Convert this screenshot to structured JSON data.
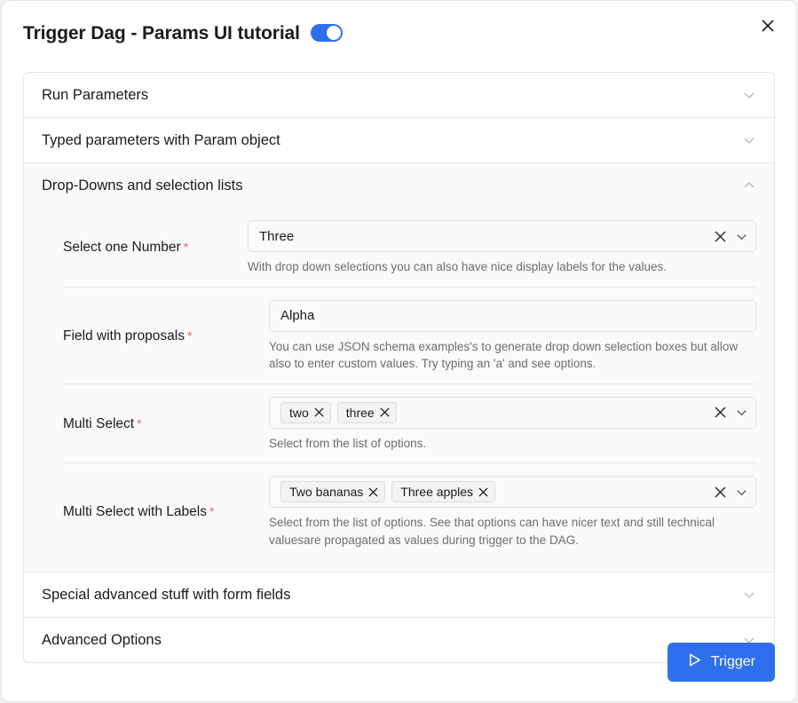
{
  "modal": {
    "title": "Trigger Dag - Params UI tutorial",
    "toggle_on": true,
    "close_icon": "close-icon",
    "accent_color": "#2f6fed",
    "required_marker": "*"
  },
  "sections": [
    {
      "label": "Run Parameters",
      "expanded": false
    },
    {
      "label": "Typed parameters with Param object",
      "expanded": false
    },
    {
      "label": "Drop-Downs and selection lists",
      "expanded": true
    },
    {
      "label": "Special advanced stuff with form fields",
      "expanded": false
    },
    {
      "label": "Advanced Options",
      "expanded": false
    }
  ],
  "fields": [
    {
      "label": "Select one Number",
      "required": true,
      "type": "select",
      "value": "Three",
      "help": "With drop down selections you can also have nice display labels for the values."
    },
    {
      "label": "Field with proposals",
      "required": true,
      "type": "text",
      "value": "Alpha",
      "help": "You can use JSON schema examples's to generate drop down selection boxes but allow also to enter custom values. Try typing an 'a' and see options."
    },
    {
      "label": "Multi Select",
      "required": true,
      "type": "multiselect",
      "chips": [
        "two",
        "three"
      ],
      "help": "Select from the list of options."
    },
    {
      "label": "Multi Select with Labels",
      "required": true,
      "type": "multiselect",
      "chips": [
        "Two bananas",
        "Three apples"
      ],
      "help": "Select from the list of options. See that options can have nicer text and still technical valuesare propagated as values during trigger to the DAG."
    }
  ],
  "footer": {
    "trigger_label": "Trigger",
    "trigger_icon": "play-icon"
  }
}
